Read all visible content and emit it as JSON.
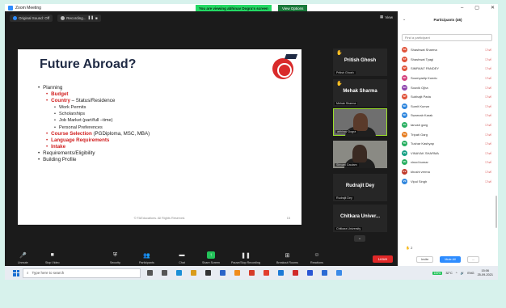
{
  "window": {
    "title": "Zoom Meeting",
    "share_banner": "You are viewing abhinav Dogra's screen",
    "view_options": "View Options",
    "controls": [
      "–",
      "▢",
      "✕"
    ]
  },
  "topbar": {
    "sound_chip": "Original Sound: Off",
    "recording_chip": "Recording...",
    "view_button": "View"
  },
  "slide": {
    "title": "Future Abroad?",
    "items": [
      {
        "level": 0,
        "text": "Planning"
      },
      {
        "level": 1,
        "text": "Budget",
        "red": true
      },
      {
        "level": 1,
        "text": "Country",
        "red": true,
        "suffix": " – Status/Residence"
      },
      {
        "level": 2,
        "text": "Work Permits"
      },
      {
        "level": 2,
        "text": "Scholarships"
      },
      {
        "level": 2,
        "text": "Job Market (part/full –time)"
      },
      {
        "level": 2,
        "text": "Personal Preferences"
      },
      {
        "level": 1,
        "text": "Course Selection",
        "red": true,
        "suffix": " (PGDiploma, MSC, MBA)"
      },
      {
        "level": 1,
        "text": "Language Requirements",
        "red": true
      },
      {
        "level": 1,
        "text": "Intake",
        "red": true
      },
      {
        "level": 0,
        "text": "Requirements/Eligibility"
      },
      {
        "level": 0,
        "text": "Building Profile"
      }
    ],
    "footer": "© FAEducations. All Rights Reserved.",
    "page": "15"
  },
  "tiles": {
    "pritish": {
      "name": "Pritish Ghosh",
      "label": "Pritish Ghosh"
    },
    "mehak": {
      "name": "Mehak Sharma",
      "label": "Mehak Sharma"
    },
    "abhinav": {
      "label": "abhinav Dogra"
    },
    "shivani": {
      "label": "Shivani Gautam"
    },
    "rudrajit": {
      "name": "Rudrajit Dey",
      "label": "Rudrajit Dey"
    },
    "chitkara": {
      "name": "Chitkara Univer...",
      "label": "Chitkara University"
    }
  },
  "panel": {
    "title": "Participants (46)",
    "search_placeholder": "Find a participant",
    "participants": [
      {
        "initials": "SS",
        "name": "Shashwat Sharma",
        "color": "#e0533a"
      },
      {
        "initials": "ST",
        "name": "Shashwat Tyagi",
        "color": "#e0533a"
      },
      {
        "initials": "SP",
        "name": "SIMRAN7 PANDEY",
        "color": "#e0533a"
      },
      {
        "initials": "SK",
        "name": "Soumyadip Kundu",
        "color": "#d4407b"
      },
      {
        "initials": "SO",
        "name": "Souvik Ojha",
        "color": "#8e44ad"
      },
      {
        "initials": "SP",
        "name": "Subhajit Paria",
        "color": "#e0533a"
      },
      {
        "initials": "SK",
        "name": "Sumit Kumar",
        "color": "#2e86de"
      },
      {
        "initials": "SK",
        "name": "Swarnab Karak",
        "color": "#2e86de"
      },
      {
        "initials": "TG",
        "name": "tanush garg",
        "color": "#27ae60"
      },
      {
        "initials": "TG",
        "name": "Tripati Garg",
        "color": "#e67e22"
      },
      {
        "initials": "TK",
        "name": "Tushar Kashyap",
        "color": "#27ae60"
      },
      {
        "initials": "VS",
        "name": "VINAYAK SHARMA",
        "color": "#16a085"
      },
      {
        "initials": "VK",
        "name": "vinod kumar",
        "color": "#27ae60"
      },
      {
        "initials": "KV",
        "name": "khushi verma",
        "color": "#c0392b"
      },
      {
        "initials": "VS",
        "name": "Vipul Singh",
        "color": "#2e86de"
      }
    ],
    "raise_count": "2",
    "invite": "Invite",
    "mute_all": "Mute All",
    "more": "..."
  },
  "toolbar": {
    "unmute": "Unmute",
    "stop_video": "Stop Video",
    "security": "Security",
    "participants": "Participants",
    "participants_count": "46",
    "chat": "Chat",
    "share_screen": "Share Screen",
    "pause_recording": "Pause/Stop Recording",
    "breakout": "Breakout Rooms",
    "reactions": "Reactions",
    "leave": "Leave"
  },
  "taskbar": {
    "search_placeholder": "Type here to search",
    "battery": "100%",
    "temperature": "32°C",
    "language": "ENG",
    "time": "15:06",
    "date": "25-09-2021",
    "app_colors": [
      "#555",
      "#555",
      "#1c8fd6",
      "#d99b1a",
      "#333",
      "#2a64c8",
      "#f08c1a",
      "#d63b2a",
      "#e23d2d",
      "#1c7ad6",
      "#d12a2a",
      "#2a56d4",
      "#2a6ad4",
      "#3b8be8"
    ]
  }
}
